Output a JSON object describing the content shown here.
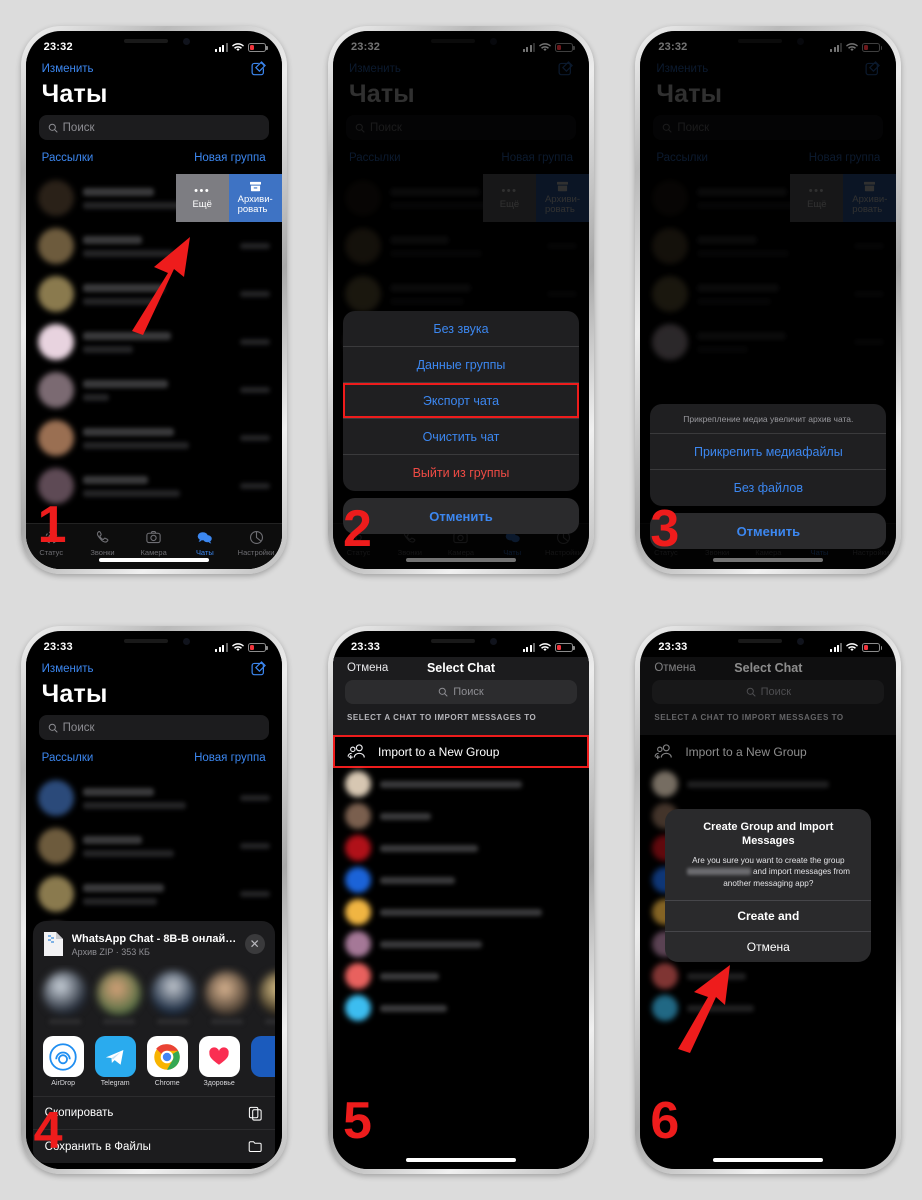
{
  "meta": {
    "background_color": "#dcdcdc",
    "accent_blue": "#3c87f0",
    "marker_red": "#ee1c1c",
    "danger_red": "#ef4b45"
  },
  "steps": [
    {
      "number": "1",
      "status": {
        "time": "23:32",
        "icons": [
          "cellular-icon",
          "wifi-icon",
          "battery-low-icon"
        ]
      },
      "app": {
        "edit_label": "Изменить",
        "compose_icon": "compose-icon",
        "title": "Чаты",
        "search_placeholder": "Поиск",
        "link_left": "Рассылки",
        "link_right": "Новая группа",
        "swipe_more": "Ещё",
        "swipe_archive": "Архиви-\nровать"
      },
      "tabbar": [
        {
          "label": "Статус",
          "icon": "status-icon",
          "active": false
        },
        {
          "label": "Звонки",
          "icon": "calls-icon",
          "active": false
        },
        {
          "label": "Камера",
          "icon": "camera-icon",
          "active": false
        },
        {
          "label": "Чаты",
          "icon": "chats-icon",
          "active": true
        },
        {
          "label": "Настройки",
          "icon": "settings-icon",
          "active": false
        }
      ]
    },
    {
      "number": "2",
      "status": {
        "time": "23:32"
      },
      "sheet": {
        "items": [
          {
            "label": "Без звука",
            "style": "normal",
            "highlighted": false
          },
          {
            "label": "Данные группы",
            "style": "normal",
            "highlighted": false
          },
          {
            "label": "Экспорт чата",
            "style": "normal",
            "highlighted": true
          },
          {
            "label": "Очистить чат",
            "style": "normal",
            "highlighted": false
          },
          {
            "label": "Выйти из группы",
            "style": "danger",
            "highlighted": false
          }
        ],
        "cancel": "Отменить"
      }
    },
    {
      "number": "3",
      "status": {
        "time": "23:32"
      },
      "sheet": {
        "header": "Прикрепление медиа увеличит архив чата.",
        "items": [
          {
            "label": "Прикрепить медиафайлы",
            "style": "normal",
            "highlighted": false
          },
          {
            "label": "Без файлов",
            "style": "normal",
            "highlighted": false
          }
        ],
        "cancel": "Отменить"
      }
    },
    {
      "number": "4",
      "status": {
        "time": "23:33"
      },
      "share": {
        "file_title": "WhatsApp Chat - 8В-В онлайн🚒…",
        "file_subtitle": "Архив ZIP · 353 КБ",
        "close_icon": "close-icon",
        "apps": [
          {
            "label": "AirDrop",
            "icon": "airdrop-icon"
          },
          {
            "label": "Telegram",
            "icon": "telegram-icon"
          },
          {
            "label": "Chrome",
            "icon": "chrome-icon"
          },
          {
            "label": "Здоровье",
            "icon": "health-icon"
          }
        ],
        "actions": [
          {
            "label": "Скопировать",
            "icon": "copy-icon"
          },
          {
            "label": "Сохранить в Файлы",
            "icon": "folder-icon"
          }
        ]
      }
    },
    {
      "number": "5",
      "status": {
        "time": "23:33"
      },
      "select_chat": {
        "cancel": "Отмена",
        "title": "Select Chat",
        "search_placeholder": "Поиск",
        "section_header": "SELECT A CHAT TO IMPORT MESSAGES TO",
        "new_group_label": "Import to a New Group",
        "new_group_icon": "add-group-icon",
        "new_group_highlighted": true
      }
    },
    {
      "number": "6",
      "status": {
        "time": "23:33"
      },
      "select_chat": {
        "cancel": "Отмена",
        "title": "Select Chat",
        "search_placeholder": "Поиск",
        "section_header": "SELECT A CHAT TO IMPORT MESSAGES TO",
        "new_group_label": "Import to a New Group",
        "new_group_icon": "add-group-icon",
        "new_group_highlighted": false
      },
      "alert": {
        "title": "Create Group and Import Messages",
        "body_before": "Are you sure you want to create the group ",
        "body_after": " and import messages from another messaging app?",
        "primary": "Create and",
        "secondary": "Отмена"
      }
    }
  ]
}
